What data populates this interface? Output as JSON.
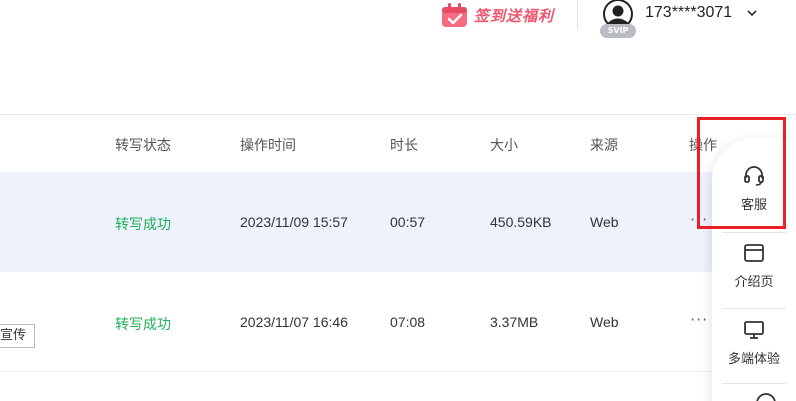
{
  "header": {
    "promo_label": "签到送福利",
    "vip_badge": "SVIP",
    "username": "173****3071"
  },
  "table": {
    "columns": [
      "转写状态",
      "操作时间",
      "时长",
      "大小",
      "来源",
      "操作"
    ],
    "rows": [
      {
        "status": "转写成功",
        "time": "2023/11/09 15:57",
        "duration": "00:57",
        "size": "450.59KB",
        "source": "Web",
        "more": "···",
        "highlighted": true
      },
      {
        "tag": "宣传",
        "status": "转写成功",
        "time": "2023/11/07 16:46",
        "duration": "07:08",
        "size": "3.37MB",
        "source": "Web",
        "more": "···",
        "highlighted": false
      }
    ]
  },
  "side_panel": {
    "items": [
      {
        "label": "客服",
        "icon": "headset-icon"
      },
      {
        "label": "介绍页",
        "icon": "browser-window-icon"
      },
      {
        "label": "多端体验",
        "icon": "monitor-icon"
      }
    ]
  },
  "colors": {
    "status_success": "#1fae5a",
    "promo": "#f0566e",
    "highlight_row": "#eef2fd",
    "annotation_box": "#ea2027"
  }
}
